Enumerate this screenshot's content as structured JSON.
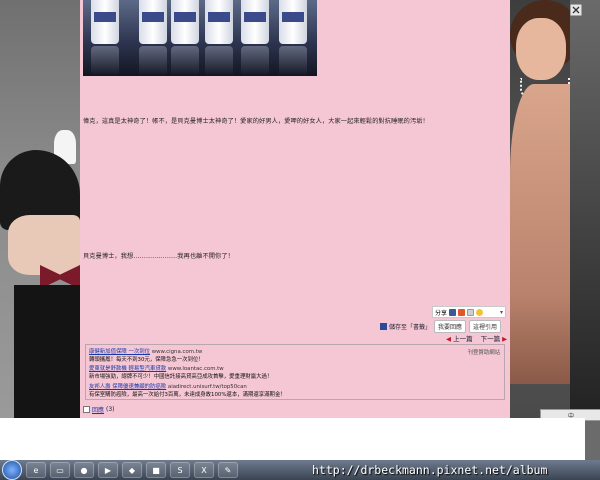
{
  "colors": {
    "content_bg": "#f5c6d4",
    "link": "#1a3aa8",
    "pager_arrow": "#c01a2a"
  },
  "article": {
    "paragraph1": "偉克，這真是太神奇了！帳不，是貝克曼博士太神奇了！愛家的好男人，愛呷的好女人，大家一起來輕鬆的對抗睡眠的汚垢！",
    "paragraph2": "貝克曼博士，我想…………………我再也離不開你了！"
  },
  "share_bar": {
    "label": "分享",
    "icons": [
      "facebook-icon",
      "plurk-icon",
      "twitter-icon",
      "smiley-icon"
    ]
  },
  "actions": {
    "favorite": "儲存至「書籤」",
    "reply": "我要回應",
    "quote": "這裡引用"
  },
  "pager": {
    "prev": "上一篇",
    "next": "下一篇"
  },
  "ads": {
    "label": "刊登贊助網站",
    "items": [
      {
        "title": "康健新加值保障 一次到位",
        "url": "www.cigna.com.tw",
        "desc": "轉頭攜鳳！每天不到30元，保障急急一次到位！"
      },
      {
        "title": "愛東就是舒款機 輕易型汽車貸款",
        "url": "www.loantac.com.tw",
        "desc": "新市場強勁，總牌不可少！中國信託接高貸高亞成攻首擊，愛重理財蠃大過！"
      },
      {
        "title": "友邦人壽 保障優速兼顧的防癌險",
        "url": "aiadirect.unisurf.tw/top50can",
        "desc": "有保室購防癌險，最高一次給付3百萬，未達成身故100%還本，滿期還享滿期金！"
      }
    ]
  },
  "comments": {
    "label": "回應",
    "count": "(3)"
  },
  "tray": {
    "text": "中"
  },
  "watermark_url": "http://drbeckmann.pixnet.net/album",
  "taskbar": {
    "items": [
      "start-orb",
      "ie-icon",
      "folder-icon",
      "chrome-icon",
      "media-icon",
      "app-icon",
      "app-icon",
      "skype-icon",
      "excel-icon",
      "paint-icon"
    ]
  }
}
